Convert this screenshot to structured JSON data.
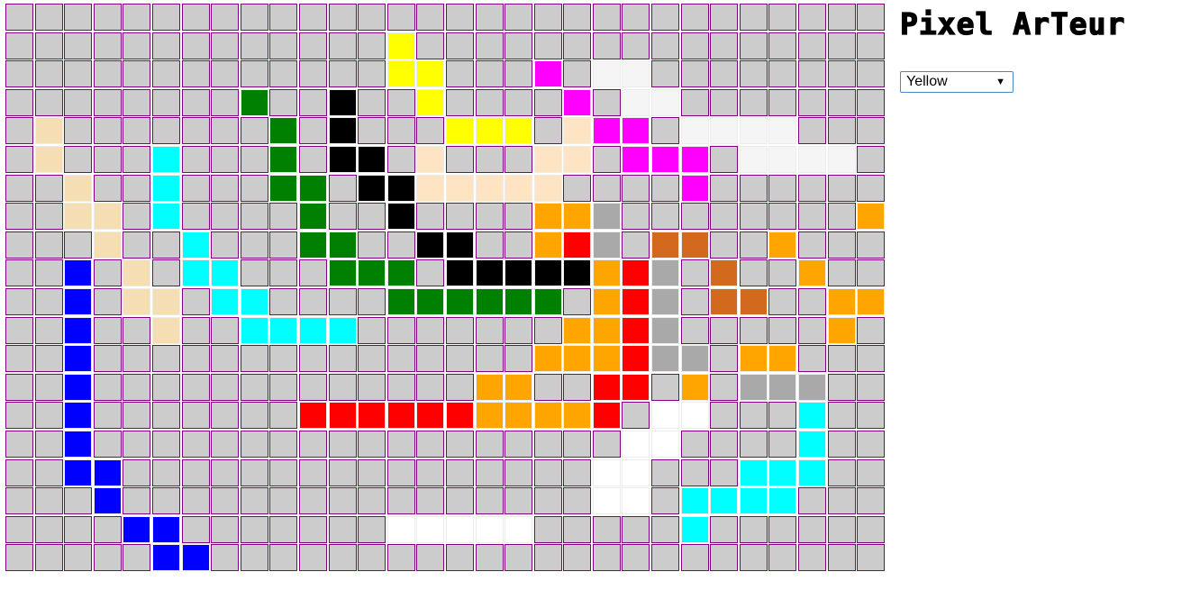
{
  "app": {
    "title": "Pixel ArTeur"
  },
  "color_picker": {
    "selected": "Yellow",
    "arrow_icon": "dropdown-arrow-icon",
    "arrow_glyph": "▼"
  },
  "canvas": {
    "columns": 30,
    "rows": 20,
    "empty_color": "#cccccc",
    "cell_border_color": "#800080",
    "palette": {
      ".": null,
      "y": "#ffff00",
      "m": "#ff00ff",
      "e": "#f5f5f5",
      "w": "#ffffff",
      "g": "#008000",
      "k": "#000000",
      "t": "#f5deb3",
      "b": "#ffe4c4",
      "c": "#00ffff",
      "o": "#ffa500",
      "a": "#a9a9a9",
      "r": "#ff0000",
      "h": "#d2691e",
      "u": "#0000ff"
    },
    "pixels": [
      "..............................",
      ".............y................",
      ".............yy...m.ee........",
      "........g..k..y....m.ee.......",
      ".t.......g.k...yyy.bmm.eeee...",
      ".t...c...g.kk.b...bb.mmm.eeee.",
      "..t..c...gg.kkbbbbb....m......",
      "..tt.c....g..k....ooa........o",
      "...t..c...gg..kk..ora.hh..o...",
      "..u.t.cc...ggg.kkkkkora.h..o..",
      "..u.tt.cc....gggggg.ora.hh..oo",
      "..u..t..cccc.......oora.....oo.",
      "..u.................oooora.aaoo..",
      "..u...............oo..rr.o.aaa...",
      "..u.......rrrrrroooor..ww..c.",
      "..u..................ww......c.",
      "..uu................ww.....ccc.",
      "...u................ww...cccc..",
      "....uu.......wwwwww......c.....",
      ".....uu......................."
    ]
  }
}
